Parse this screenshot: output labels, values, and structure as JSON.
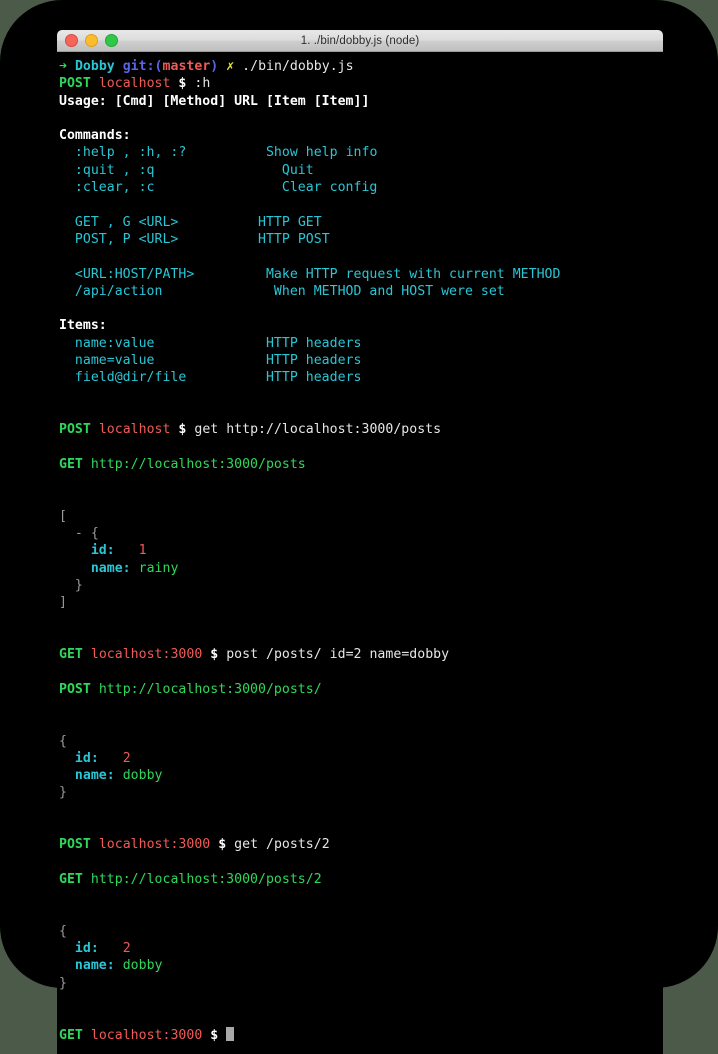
{
  "window": {
    "title": "1. ./bin/dobby.js (node)",
    "traffic_lights": [
      "close",
      "minimize",
      "maximize"
    ]
  },
  "theme": {
    "background": "#000000",
    "foreground": "#d9d9d9",
    "green": "#2fd85a",
    "red": "#f05a57",
    "cyan": "#29c6d6",
    "blue": "#5b63e8",
    "yellow": "#e8e336",
    "white": "#ffffff",
    "gray": "#9a9a9a",
    "desktop": "#4b5a49"
  },
  "terminal": {
    "shell_prompt": {
      "arrow": "➜",
      "dir": "Dobby",
      "git_prefix": "git:(",
      "git_branch": "master",
      "git_suffix": ")",
      "dirty_mark": "✗",
      "command": "./bin/dobby.js"
    },
    "prompt1": {
      "method": "POST",
      "host": "localhost",
      "sigil": "$",
      "command": ":h"
    },
    "usage": "Usage: [Cmd] [Method] URL [Item [Item]]",
    "commands_header": "Commands:",
    "commands": [
      {
        "syntax": "  :help , :h, :?",
        "desc": "Show help info"
      },
      {
        "syntax": "  :quit , :q",
        "desc": "Quit"
      },
      {
        "syntax": "  :clear, :c",
        "desc": "Clear config"
      },
      {
        "syntax": "  GET , G <URL>",
        "desc": "HTTP GET"
      },
      {
        "syntax": "  POST, P <URL>",
        "desc": "HTTP POST"
      },
      {
        "syntax": "  <URL:HOST/PATH>",
        "desc": "Make HTTP request with current METHOD"
      },
      {
        "syntax": "  /api/action",
        "desc": "When METHOD and HOST were set"
      }
    ],
    "items_header": "Items:",
    "items": [
      {
        "syntax": "  name:value",
        "desc": "HTTP headers"
      },
      {
        "syntax": "  name=value",
        "desc": "HTTP headers"
      },
      {
        "syntax": "  field@dir/file",
        "desc": "HTTP headers"
      }
    ],
    "prompt2": {
      "method": "POST",
      "host": "localhost",
      "sigil": "$",
      "command": "get http://localhost:3000/posts"
    },
    "response1_header": {
      "method": "GET",
      "url": "http://localhost:3000/posts"
    },
    "response1_body": {
      "open_bracket": "[",
      "dash": "- ",
      "open_brace": "{",
      "fields": [
        {
          "key": "id:",
          "pad": "   ",
          "value": "1",
          "type": "number"
        },
        {
          "key": "name:",
          "pad": " ",
          "value": "rainy",
          "type": "string"
        }
      ],
      "close_brace": "}",
      "close_bracket": "]"
    },
    "prompt3": {
      "method": "GET",
      "host": "localhost:3000",
      "sigil": "$",
      "command": "post /posts/ id=2 name=dobby"
    },
    "response2_header": {
      "method": "POST",
      "url": "http://localhost:3000/posts/"
    },
    "response2_body": {
      "open_brace": "{",
      "fields": [
        {
          "key": "id:",
          "pad": "   ",
          "value": "2",
          "type": "number"
        },
        {
          "key": "name:",
          "pad": " ",
          "value": "dobby",
          "type": "string"
        }
      ],
      "close_brace": "}"
    },
    "prompt4": {
      "method": "POST",
      "host": "localhost:3000",
      "sigil": "$",
      "command": "get /posts/2"
    },
    "response3_header": {
      "method": "GET",
      "url": "http://localhost:3000/posts/2"
    },
    "response3_body": {
      "open_brace": "{",
      "fields": [
        {
          "key": "id:",
          "pad": "   ",
          "value": "2",
          "type": "number"
        },
        {
          "key": "name:",
          "pad": " ",
          "value": "dobby",
          "type": "string"
        }
      ],
      "close_brace": "}"
    },
    "prompt5": {
      "method": "GET",
      "host": "localhost:3000",
      "sigil": "$",
      "command": ""
    }
  }
}
